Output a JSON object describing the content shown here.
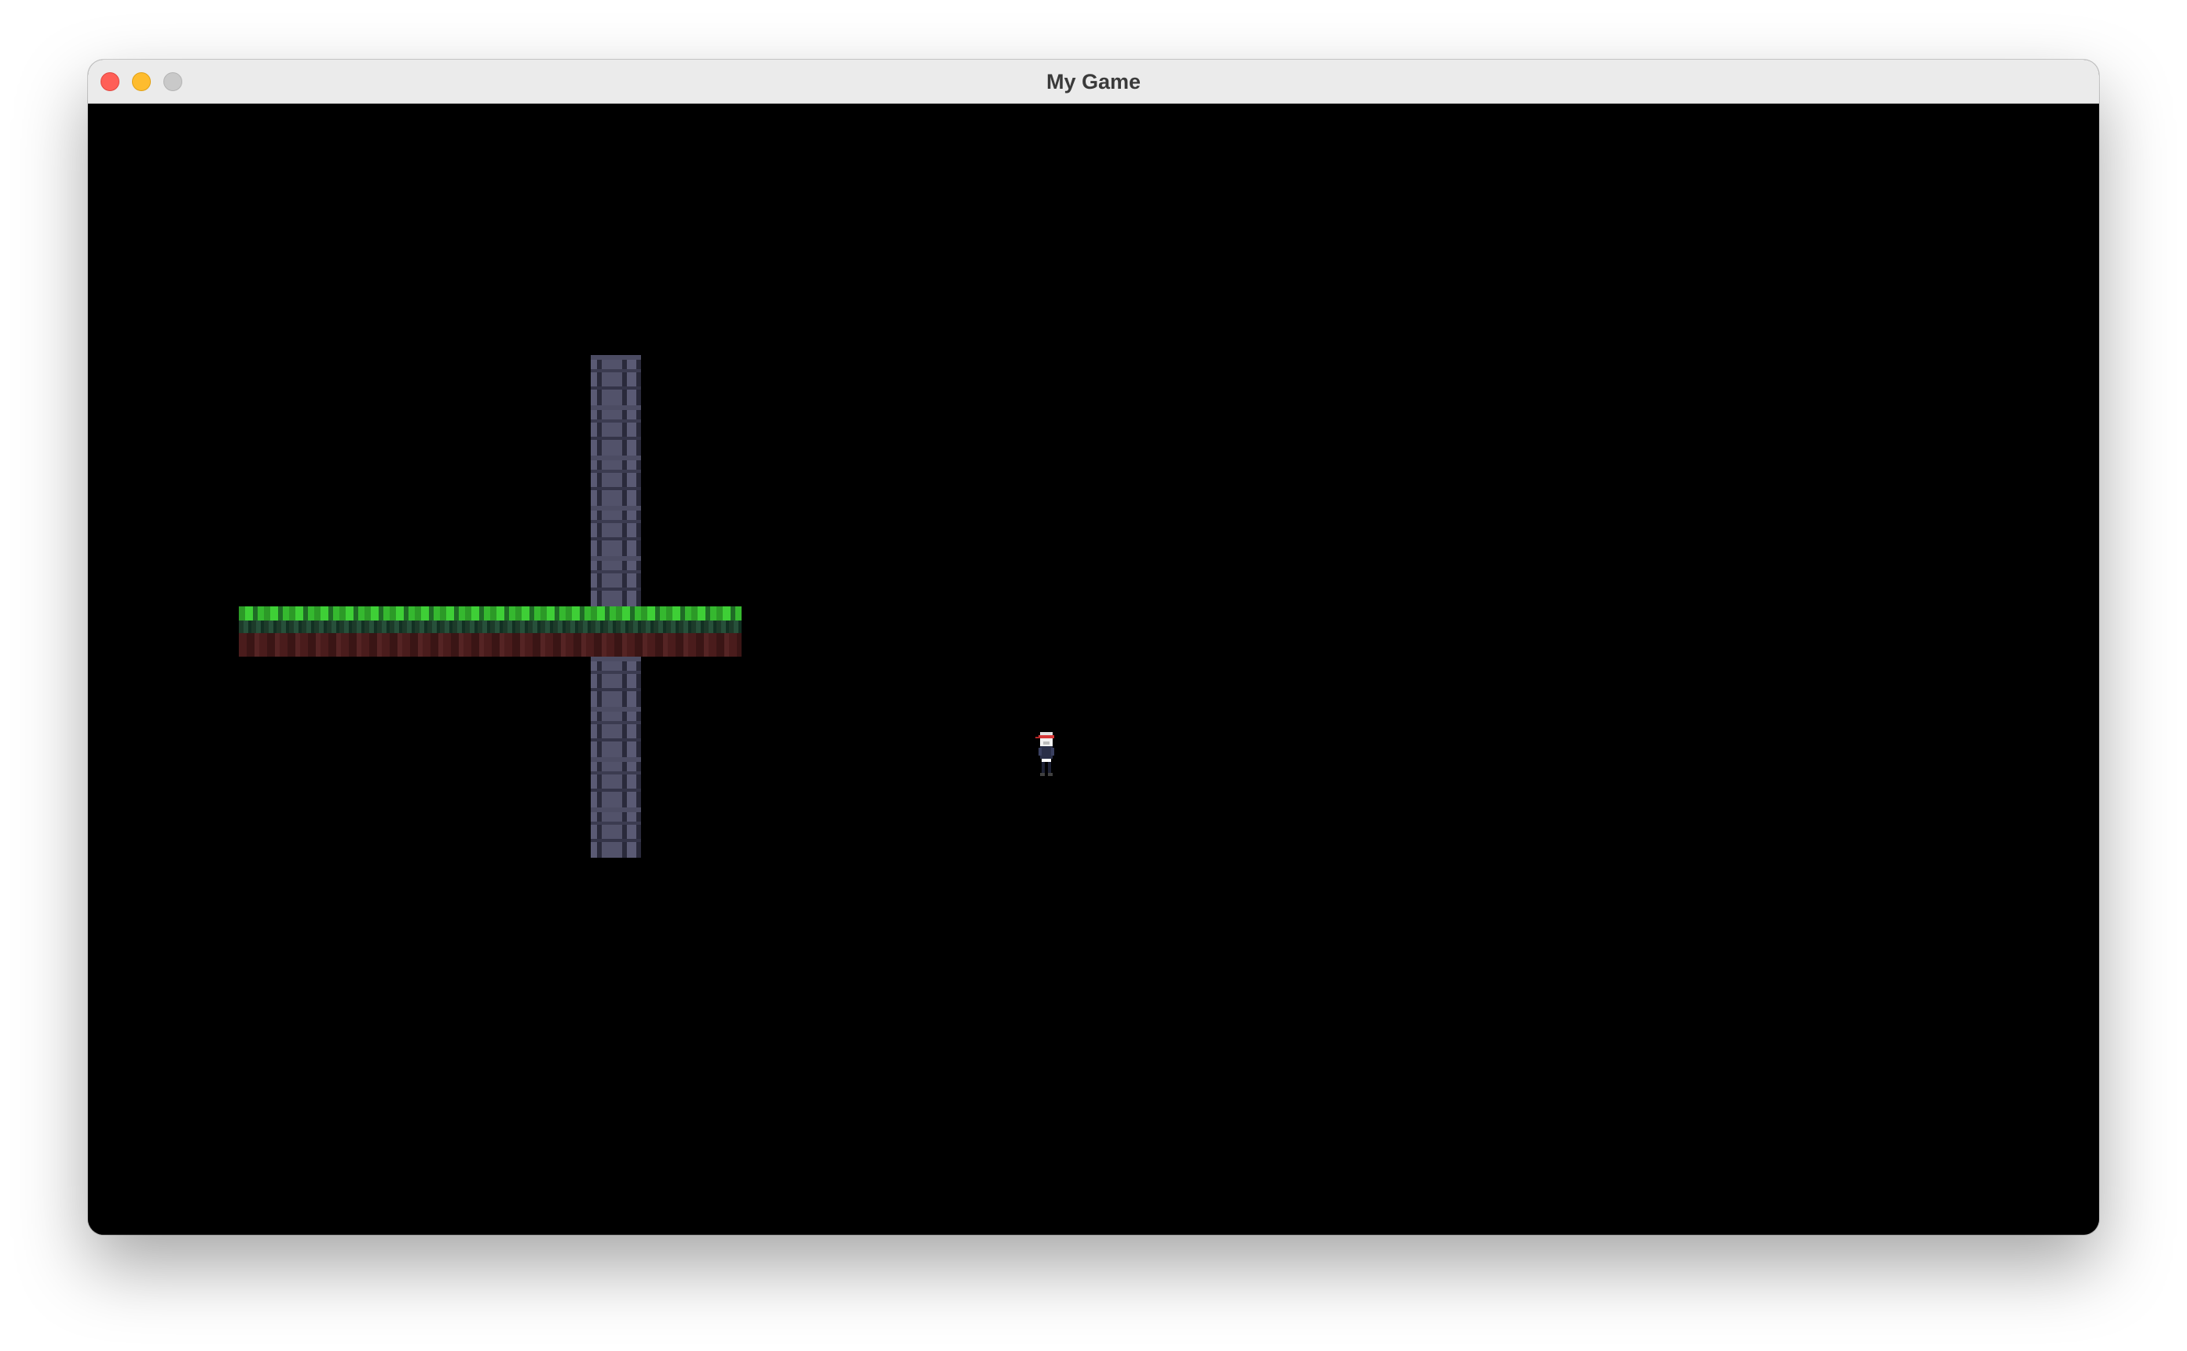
{
  "window": {
    "title": "My Game"
  },
  "colors": {
    "background": "#000000",
    "grass": "#3ecf36",
    "dirt": "#3b1717",
    "stone": "#2a2a3b",
    "player_hat": "#d63838"
  },
  "scene": {
    "tiles": [
      "stone-column",
      "grass-platform"
    ],
    "player": "player-sprite"
  }
}
